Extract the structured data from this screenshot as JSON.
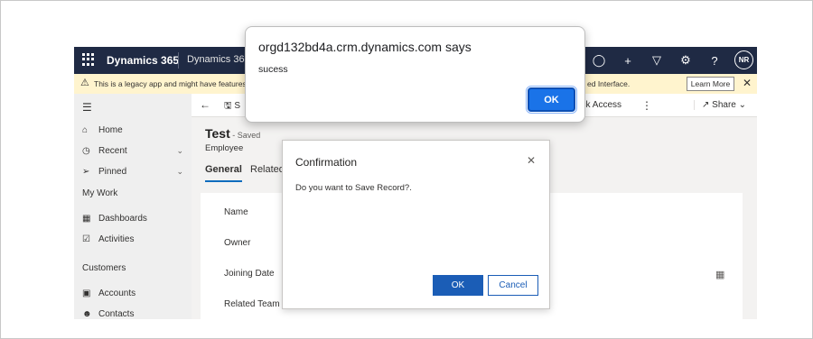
{
  "nav": {
    "brand": "Dynamics 365",
    "app_name": "Dynamics 365 –",
    "icons": [
      "lightbulb-icon",
      "plus-icon",
      "filter-icon",
      "gear-icon",
      "help-icon"
    ],
    "avatar": "NR"
  },
  "banner": {
    "text_left": "This is a legacy app and might have features or",
    "text_right": "ed Interface.",
    "learn_more": "Learn More"
  },
  "sidebar": {
    "items": [
      {
        "label": "Home",
        "icon": "home-icon"
      },
      {
        "label": "Recent",
        "icon": "clock-icon"
      },
      {
        "label": "Pinned",
        "icon": "pin-icon"
      }
    ],
    "section1": "My Work",
    "work_items": [
      {
        "label": "Dashboards",
        "icon": "dashboard-icon"
      },
      {
        "label": "Activities",
        "icon": "activities-icon"
      }
    ],
    "section2": "Customers",
    "customer_items": [
      {
        "label": "Accounts",
        "icon": "accounts-icon"
      },
      {
        "label": "Contacts",
        "icon": "contacts-icon"
      }
    ]
  },
  "cmdbar": {
    "save": "S",
    "check_access": "eck Access",
    "share": "Share"
  },
  "record": {
    "title": "Test",
    "status": " - Saved",
    "entity": "Employee",
    "tabs": [
      "General",
      "Related"
    ]
  },
  "form": {
    "fields": [
      "Name",
      "Owner",
      "Joining Date",
      "Related Team"
    ]
  },
  "confirm": {
    "title": "Confirmation",
    "message": "Do you want to Save Record?.",
    "ok": "OK",
    "cancel": "Cancel"
  },
  "alert": {
    "title": "orgd132bd4a.crm.dynamics.com says",
    "message": "sucess",
    "ok": "OK"
  }
}
